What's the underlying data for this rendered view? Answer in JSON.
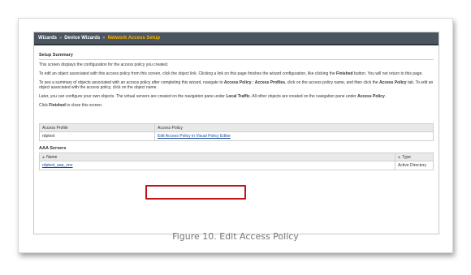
{
  "breadcrumb": {
    "root": "Wizards",
    "separator1": "»",
    "middle": "Device Wizards",
    "separator2": "»",
    "current": "Network Access Setup"
  },
  "setup_summary": {
    "title": "Setup Summary",
    "intro": "This screen displays the configuration for the access policy you created.",
    "para2_a": "To edit an object associated with this access policy from this screen, click the object link. Clicking a link on this page finishes the wizard configuration, like clicking the ",
    "para2_b": "Finished",
    "para2_c": " button. You will not return to this page.",
    "para3_a": "To see a summary of objects associated with an access policy after completing this wizard, navigate to ",
    "para3_b": "Access Policy : Access Profiles",
    "para3_c": ", click on the access policy name, and then click the ",
    "para3_d": "Access Policy",
    "para3_e": " tab. To edit an object associated with the access policy, click on the object name.",
    "para4_a": "Later, you can configure your own objects. The virtual servers are created on the navigation pane under ",
    "para4_b": "Local Traffic",
    "para4_c": ". All other objects are created on the navigation pane under ",
    "para4_d": "Access Policy",
    "para4_e": ".",
    "para5_a": "Click ",
    "para5_b": "Finished",
    "para5_c": " to close this screen."
  },
  "access_table": {
    "col1": "Access Profile",
    "col2": "Access Policy",
    "profile": "rdptest",
    "policy_link": "Edit Access Policy in Visual Policy Editor"
  },
  "aaa": {
    "title": "AAA Servers",
    "sort_icon": "sort-icon",
    "col_name": "Name",
    "col_type": "Type",
    "server_name": "rdptest_aaa_srvr",
    "server_type": "Active Directory"
  },
  "caption": "Figure 10. Edit Access Policy",
  "colors": {
    "title_bar": "#4a5560",
    "breadcrumb_active": "#ffb400",
    "highlight": "#c0141a",
    "link": "#1a4a9c"
  }
}
